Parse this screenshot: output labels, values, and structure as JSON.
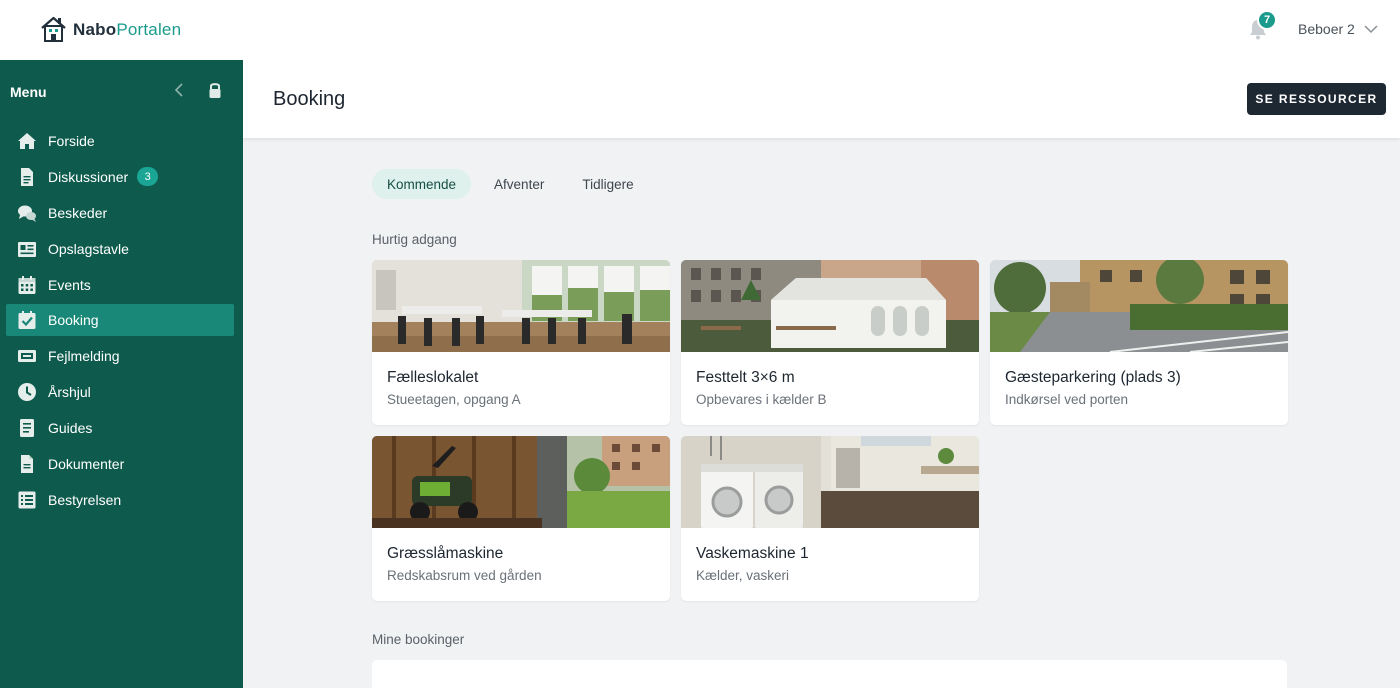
{
  "app": {
    "logo_bold": "Nabo",
    "logo_light": "Portalen",
    "notifications_count": "7",
    "user_name": "Beboer 2"
  },
  "sidebar": {
    "title": "Menu",
    "items": [
      {
        "label": "Forside",
        "icon": "home-icon"
      },
      {
        "label": "Diskussioner",
        "icon": "document-icon",
        "badge": "3"
      },
      {
        "label": "Beskeder",
        "icon": "chat-icon"
      },
      {
        "label": "Opslagstavle",
        "icon": "board-icon"
      },
      {
        "label": "Events",
        "icon": "calendar-icon"
      },
      {
        "label": "Booking",
        "icon": "calendar-check-icon",
        "active": true
      },
      {
        "label": "Fejlmelding",
        "icon": "ticket-icon"
      },
      {
        "label": "Årshjul",
        "icon": "clock-icon"
      },
      {
        "label": "Guides",
        "icon": "guide-icon"
      },
      {
        "label": "Dokumenter",
        "icon": "file-icon"
      },
      {
        "label": "Bestyrelsen",
        "icon": "list-icon"
      }
    ]
  },
  "page": {
    "title": "Booking",
    "primary_button": "SE RESSOURCER"
  },
  "tabs": [
    {
      "label": "Kommende",
      "active": true
    },
    {
      "label": "Afventer"
    },
    {
      "label": "Tidligere"
    }
  ],
  "quick_access": {
    "label": "Hurtig adgang",
    "cards": [
      {
        "title": "Fælleslokalet",
        "subtitle": "Stueetagen, opgang A",
        "image": "room-photo"
      },
      {
        "title": "Festtelt 3×6 m",
        "subtitle": "Opbevares i kælder B",
        "image": "tent-photo"
      },
      {
        "title": "Gæsteparkering (plads 3)",
        "subtitle": "Indkørsel ved porten",
        "image": "parking-photo"
      },
      {
        "title": "Græsslåmaskine",
        "subtitle": "Redskabsrum ved gården",
        "image": "mower-photo"
      },
      {
        "title": "Vaskemaskine 1",
        "subtitle": "Kælder, vaskeri",
        "image": "laundry-photo"
      }
    ]
  },
  "my_bookings": {
    "label": "Mine bookinger"
  },
  "colors": {
    "sidebar": "#0e5b4e",
    "sidebar_active": "#1a8878",
    "accent": "#1a9b8c",
    "button": "#1e2833",
    "background": "#f1f2f4"
  }
}
